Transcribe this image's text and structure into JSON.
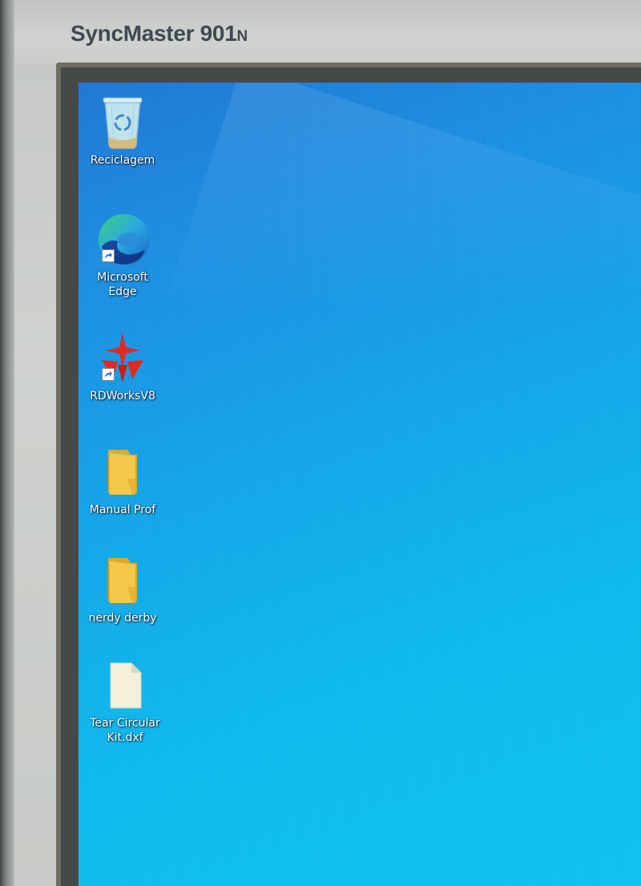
{
  "monitor": {
    "brand_main": "SyncMaster 901",
    "brand_suffix": "N"
  },
  "desktop": {
    "icons": [
      {
        "label": "Reciclagem",
        "icon": "recycle-bin-icon"
      },
      {
        "label": "Microsoft Edge",
        "icon": "edge-icon",
        "shortcut": true
      },
      {
        "label": "RDWorksV8",
        "icon": "rdworks-icon",
        "shortcut": true
      },
      {
        "label": "Manual Prof",
        "icon": "folder-icon"
      },
      {
        "label": "nerdy derby",
        "icon": "folder-icon"
      },
      {
        "label": "Tear Circular Kit.dxf",
        "icon": "file-icon"
      }
    ]
  },
  "colors": {
    "wallpaper_top": "#1d78d6",
    "wallpaper_bottom": "#0cc4f1",
    "folder": "#f4c84a",
    "rdworks_red": "#e02a22"
  }
}
